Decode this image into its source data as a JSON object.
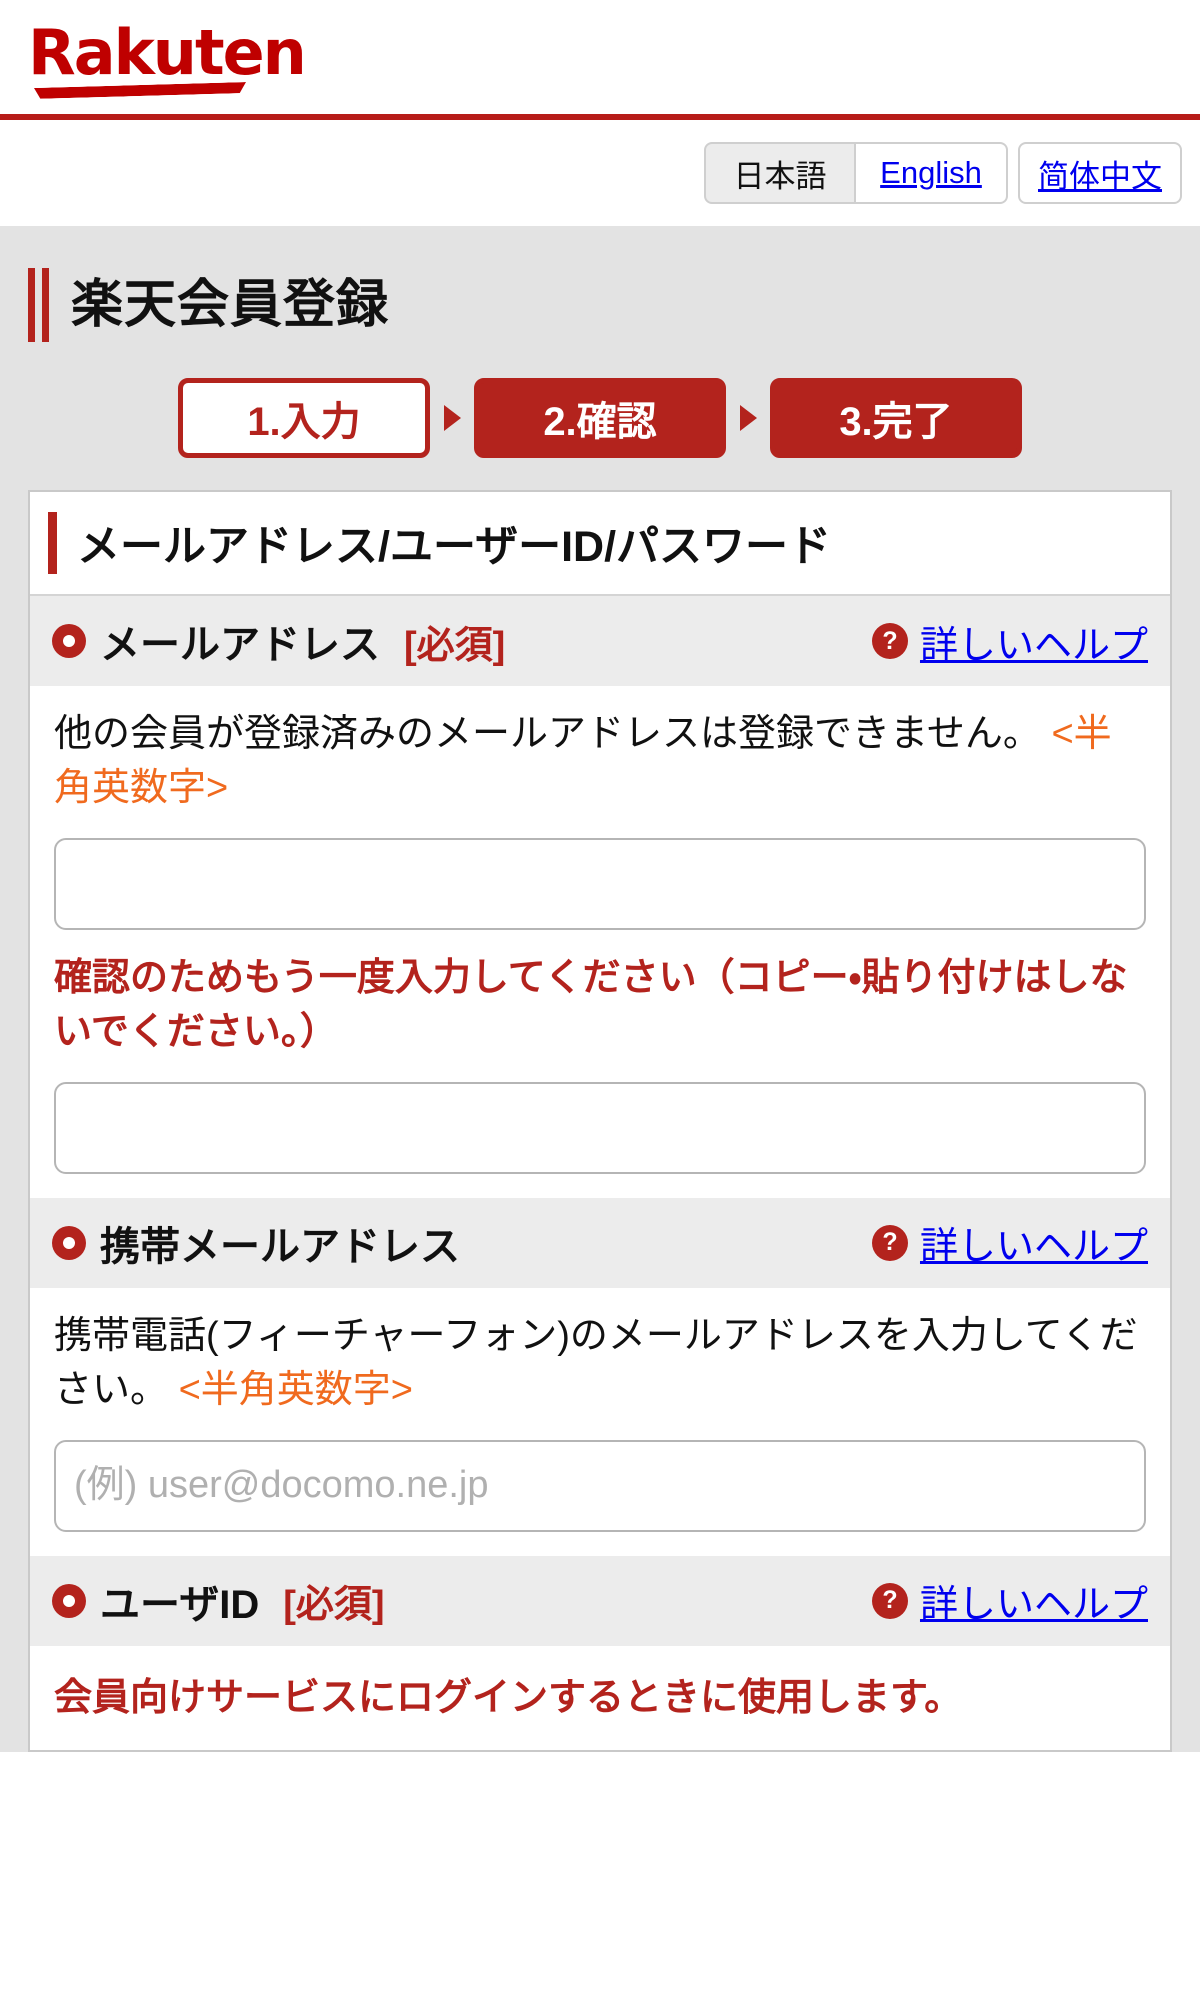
{
  "brand": {
    "logo_text": "Rakuten",
    "brand_color": "#bf0000",
    "rule_color": "#b71c18"
  },
  "language_bar": {
    "options": [
      {
        "label": "日本語",
        "selected": true
      },
      {
        "label": "English",
        "selected": false
      },
      {
        "label": "简体中文",
        "selected": false
      }
    ]
  },
  "page": {
    "title": "楽天会員登録",
    "accent_color": "#b3231d",
    "background": "#e3e3e3"
  },
  "steps": [
    {
      "label": "1.入力",
      "state": "current"
    },
    {
      "label": "2.確認",
      "state": "done"
    },
    {
      "label": "3.完了",
      "state": "done"
    }
  ],
  "section": {
    "heading": "メールアドレス/ユーザーID/パスワード"
  },
  "fields": [
    {
      "name": "メールアドレス",
      "required_badge": "[必須]",
      "help_label": "詳しいヘルプ",
      "description_main": "他の会員が登録済みのメールアドレスは登録できません。",
      "description_hint": "<半角英数字>",
      "input_value": "",
      "input_placeholder": "",
      "confirm_note": "確認のためもう一度入力してください（コピー・貼り付けはしないでください。）",
      "confirm_value": "",
      "confirm_placeholder": ""
    },
    {
      "name": "携帯メールアドレス",
      "required_badge": "",
      "help_label": "詳しいヘルプ",
      "description_main": "携帯電話(フィーチャーフォン)のメールアドレスを入力してください。",
      "description_hint": "<半角英数字>",
      "input_value": "",
      "input_placeholder": "(例) user@docomo.ne.jp"
    },
    {
      "name": "ユーザID",
      "required_badge": "[必須]",
      "help_label": "詳しいヘルプ",
      "note_red": "会員向けサービスにログインするときに使用します。"
    }
  ]
}
